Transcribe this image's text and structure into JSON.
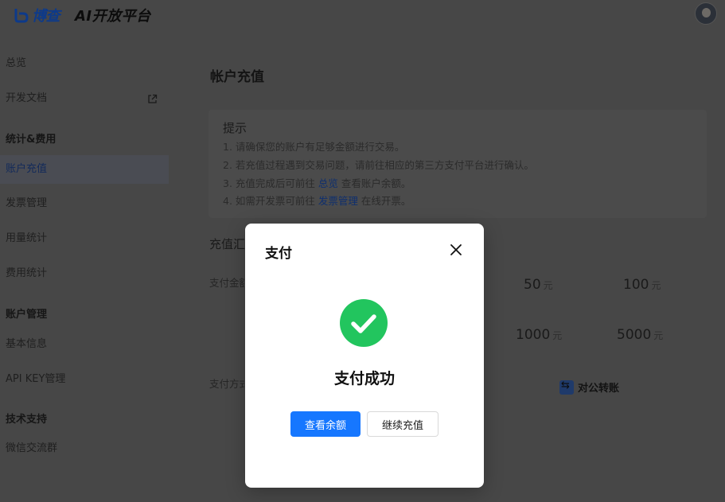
{
  "header": {
    "logo_text": "博查",
    "platform_title": "AI开放平台",
    "logo_icon": "bocha-logo-icon",
    "avatar_icon": "user-avatar"
  },
  "sidebar": {
    "overview": "总览",
    "dev_docs": "开发文档",
    "group_stats": "统计&费用",
    "recharge": "账户充值",
    "invoice": "发票管理",
    "usage": "用量统计",
    "cost": "费用统计",
    "group_account": "账户管理",
    "basic_info": "基本信息",
    "api_key": "API KEY管理",
    "group_support": "技术支持",
    "wechat_group": "微信交流群",
    "external_icon": "external-link-icon"
  },
  "main": {
    "page_title": "帐户充值",
    "tips": {
      "title": "提示",
      "line1": "1. 请确保您的账户有足够金额进行交易。",
      "line2": "2. 若充值过程遇到交易问题，请前往相应的第三方支付平台进行确认。",
      "line3_pre": "3. 充值完成后可前往 ",
      "line3_link": "总览",
      "line3_post": " 查看账户余额。",
      "line4_pre": "4. 如需开发票可前往 ",
      "line4_link": "发票管理",
      "line4_post": " 在线开票。"
    },
    "section_title": "充值汇总",
    "amount_label": "支付金额",
    "method_label": "支付方式",
    "unit": "元",
    "amounts": [
      "50",
      "100",
      "1000",
      "5000"
    ],
    "pay_method": "对公转账",
    "pay_method_icon": "transfer-icon"
  },
  "modal": {
    "title": "支付",
    "success_text": "支付成功",
    "check_balance_label": "查看余额",
    "continue_label": "继续充值",
    "close_icon": "close-icon",
    "success_icon": "check-circle-icon"
  },
  "colors": {
    "primary": "#1677ff",
    "success": "#22c55e"
  }
}
